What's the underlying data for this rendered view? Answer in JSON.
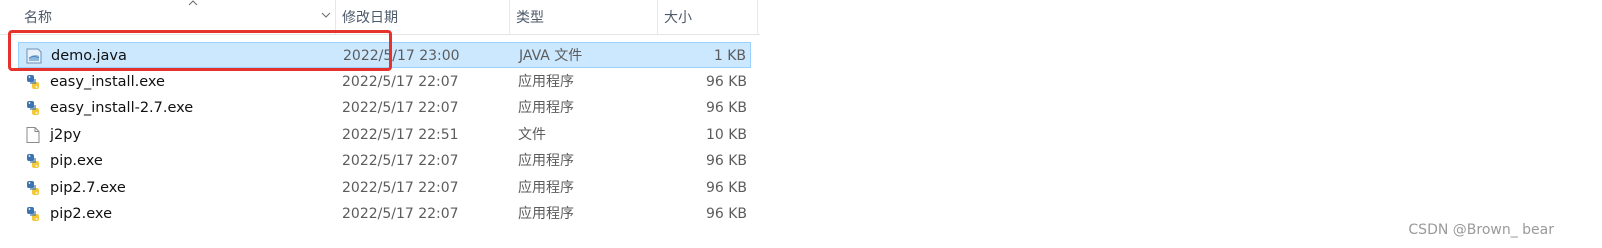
{
  "columns": {
    "name": "名称",
    "date": "修改日期",
    "type": "类型",
    "size": "大小"
  },
  "files": [
    {
      "name": "demo.java",
      "date": "2022/5/17 23:00",
      "type": "JAVA 文件",
      "size": "1 KB",
      "icon": "java-file-icon",
      "selected": true
    },
    {
      "name": "easy_install.exe",
      "date": "2022/5/17 22:07",
      "type": "应用程序",
      "size": "96 KB",
      "icon": "python-exe-icon"
    },
    {
      "name": "easy_install-2.7.exe",
      "date": "2022/5/17 22:07",
      "type": "应用程序",
      "size": "96 KB",
      "icon": "python-exe-icon"
    },
    {
      "name": "j2py",
      "date": "2022/5/17 22:51",
      "type": "文件",
      "size": "10 KB",
      "icon": "blank-file-icon"
    },
    {
      "name": "pip.exe",
      "date": "2022/5/17 22:07",
      "type": "应用程序",
      "size": "96 KB",
      "icon": "python-exe-icon"
    },
    {
      "name": "pip2.7.exe",
      "date": "2022/5/17 22:07",
      "type": "应用程序",
      "size": "96 KB",
      "icon": "python-exe-icon"
    },
    {
      "name": "pip2.exe",
      "date": "2022/5/17 22:07",
      "type": "应用程序",
      "size": "96 KB",
      "icon": "python-exe-icon"
    }
  ],
  "watermark": "CSDN @Brown_ bear",
  "colors": {
    "selection": "#cce8ff",
    "annotation": "#e5322d"
  }
}
